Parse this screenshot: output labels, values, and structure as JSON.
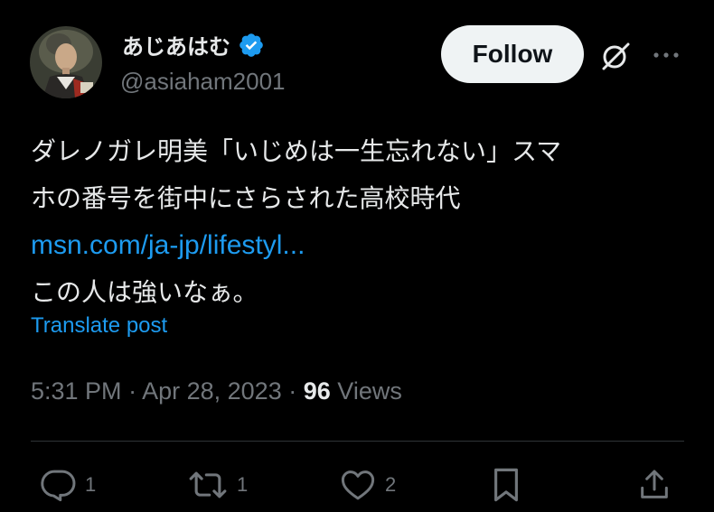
{
  "user": {
    "display_name": "あじあはむ",
    "handle": "@asiaham2001",
    "verified": true
  },
  "header": {
    "follow_label": "Follow"
  },
  "tweet": {
    "text_line1": "ダレノガレ明美「いじめは一生忘れない」スマ",
    "text_line2": "ホの番号を街中にさらされた高校時代",
    "link_text": "msn.com/ja-jp/lifestyl...",
    "text_line3": "この人は強いなぁ。",
    "translate_label": "Translate post",
    "time": "5:31 PM",
    "date": "Apr 28, 2023",
    "views_count": "96",
    "views_label": "Views"
  },
  "actions": {
    "replies": "1",
    "reposts": "1",
    "likes": "2"
  },
  "colors": {
    "background": "#000000",
    "text": "#e7e9ea",
    "secondary": "#71767b",
    "accent": "#1d9bf0",
    "divider": "#2f3336"
  },
  "icons": [
    "verified-badge-icon",
    "grok-icon",
    "more-icon",
    "reply-icon",
    "repost-icon",
    "like-icon",
    "bookmark-icon",
    "share-icon"
  ]
}
